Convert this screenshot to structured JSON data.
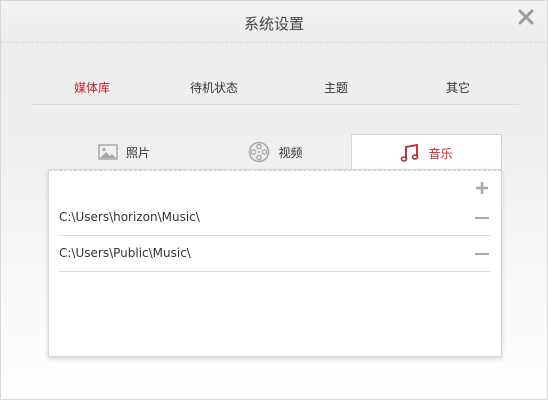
{
  "window": {
    "title": "系统设置",
    "close_icon": "close-icon"
  },
  "top_tabs": [
    {
      "label": "媒体库",
      "active": true
    },
    {
      "label": "待机状态",
      "active": false
    },
    {
      "label": "主题",
      "active": false
    },
    {
      "label": "其它",
      "active": false
    }
  ],
  "media_tabs": [
    {
      "label": "照片",
      "icon": "photo-icon",
      "active": false
    },
    {
      "label": "视频",
      "icon": "film-reel-icon",
      "active": false
    },
    {
      "label": "音乐",
      "icon": "music-note-icon",
      "active": true
    }
  ],
  "music_library": {
    "add_icon": "plus-icon",
    "folders": [
      {
        "path": "C:\\Users\\horizon\\Music\\",
        "remove_icon": "minus-icon"
      },
      {
        "path": "C:\\Users\\Public\\Music\\",
        "remove_icon": "minus-icon"
      }
    ]
  },
  "colors": {
    "accent": "#c0252a",
    "text": "#333333",
    "icon_gray": "#a8a8a8"
  }
}
